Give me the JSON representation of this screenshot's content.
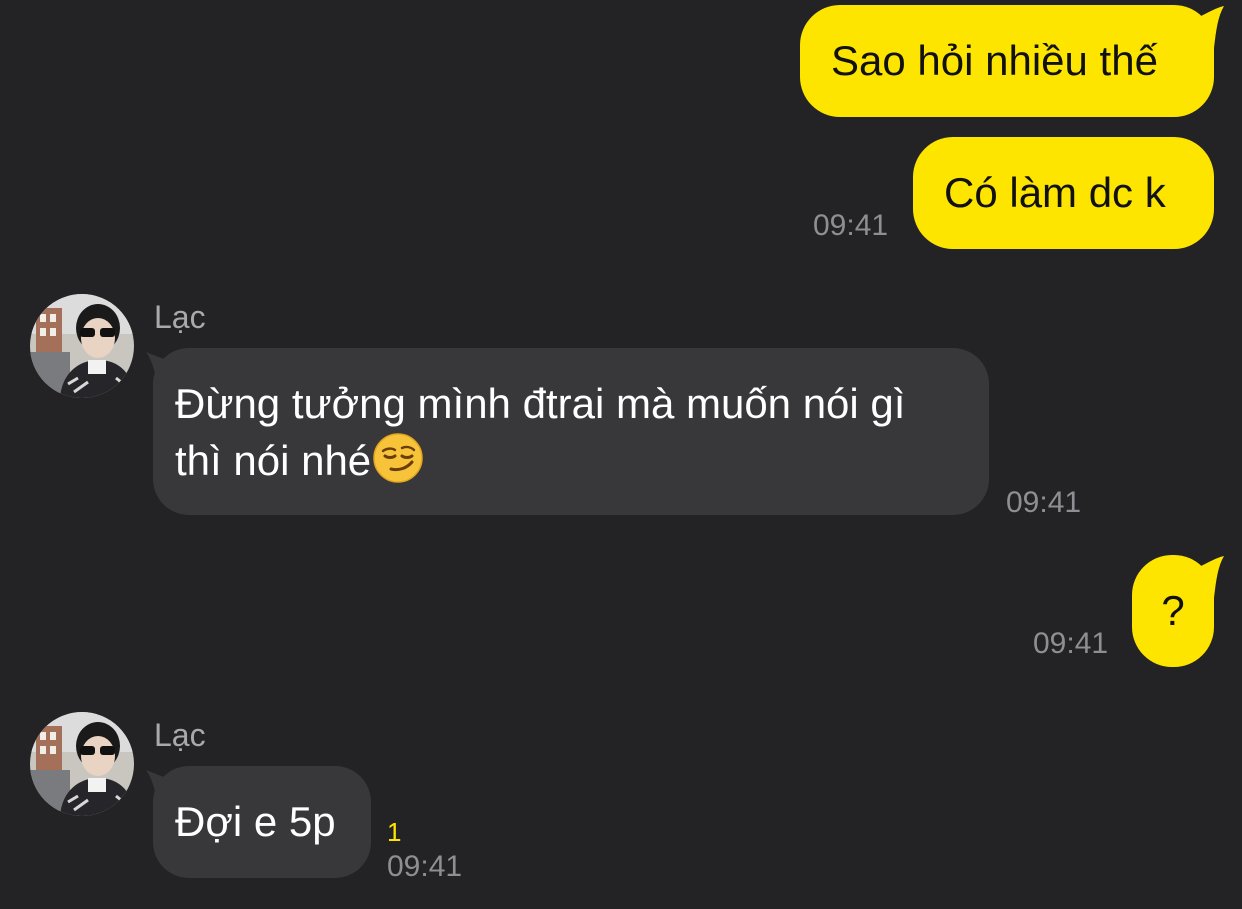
{
  "colors": {
    "background": "#232325",
    "outgoing_bubble": "#FEE500",
    "incoming_bubble": "#38383b",
    "timestamp": "#8e8e93",
    "unread_count": "#FEE500"
  },
  "messages": [
    {
      "direction": "outgoing",
      "text": "Sao hỏi nhiều thế"
    },
    {
      "direction": "outgoing",
      "text": "Có làm dc k",
      "time": "09:41"
    },
    {
      "direction": "incoming",
      "sender": "Lạc",
      "avatar": "profile-photo",
      "text_line1": "Đừng tưởng mình đtrai mà muốn nói gì",
      "text_line2": "thì nói nhé",
      "emoji": "😏",
      "emoji_name": "smirking-face-emoji",
      "time": "09:41"
    },
    {
      "direction": "outgoing",
      "text": "?",
      "time": "09:41"
    },
    {
      "direction": "incoming",
      "sender": "Lạc",
      "avatar": "profile-photo",
      "text": "Đợi e 5p",
      "unread_count": "1",
      "time": "09:41"
    }
  ]
}
